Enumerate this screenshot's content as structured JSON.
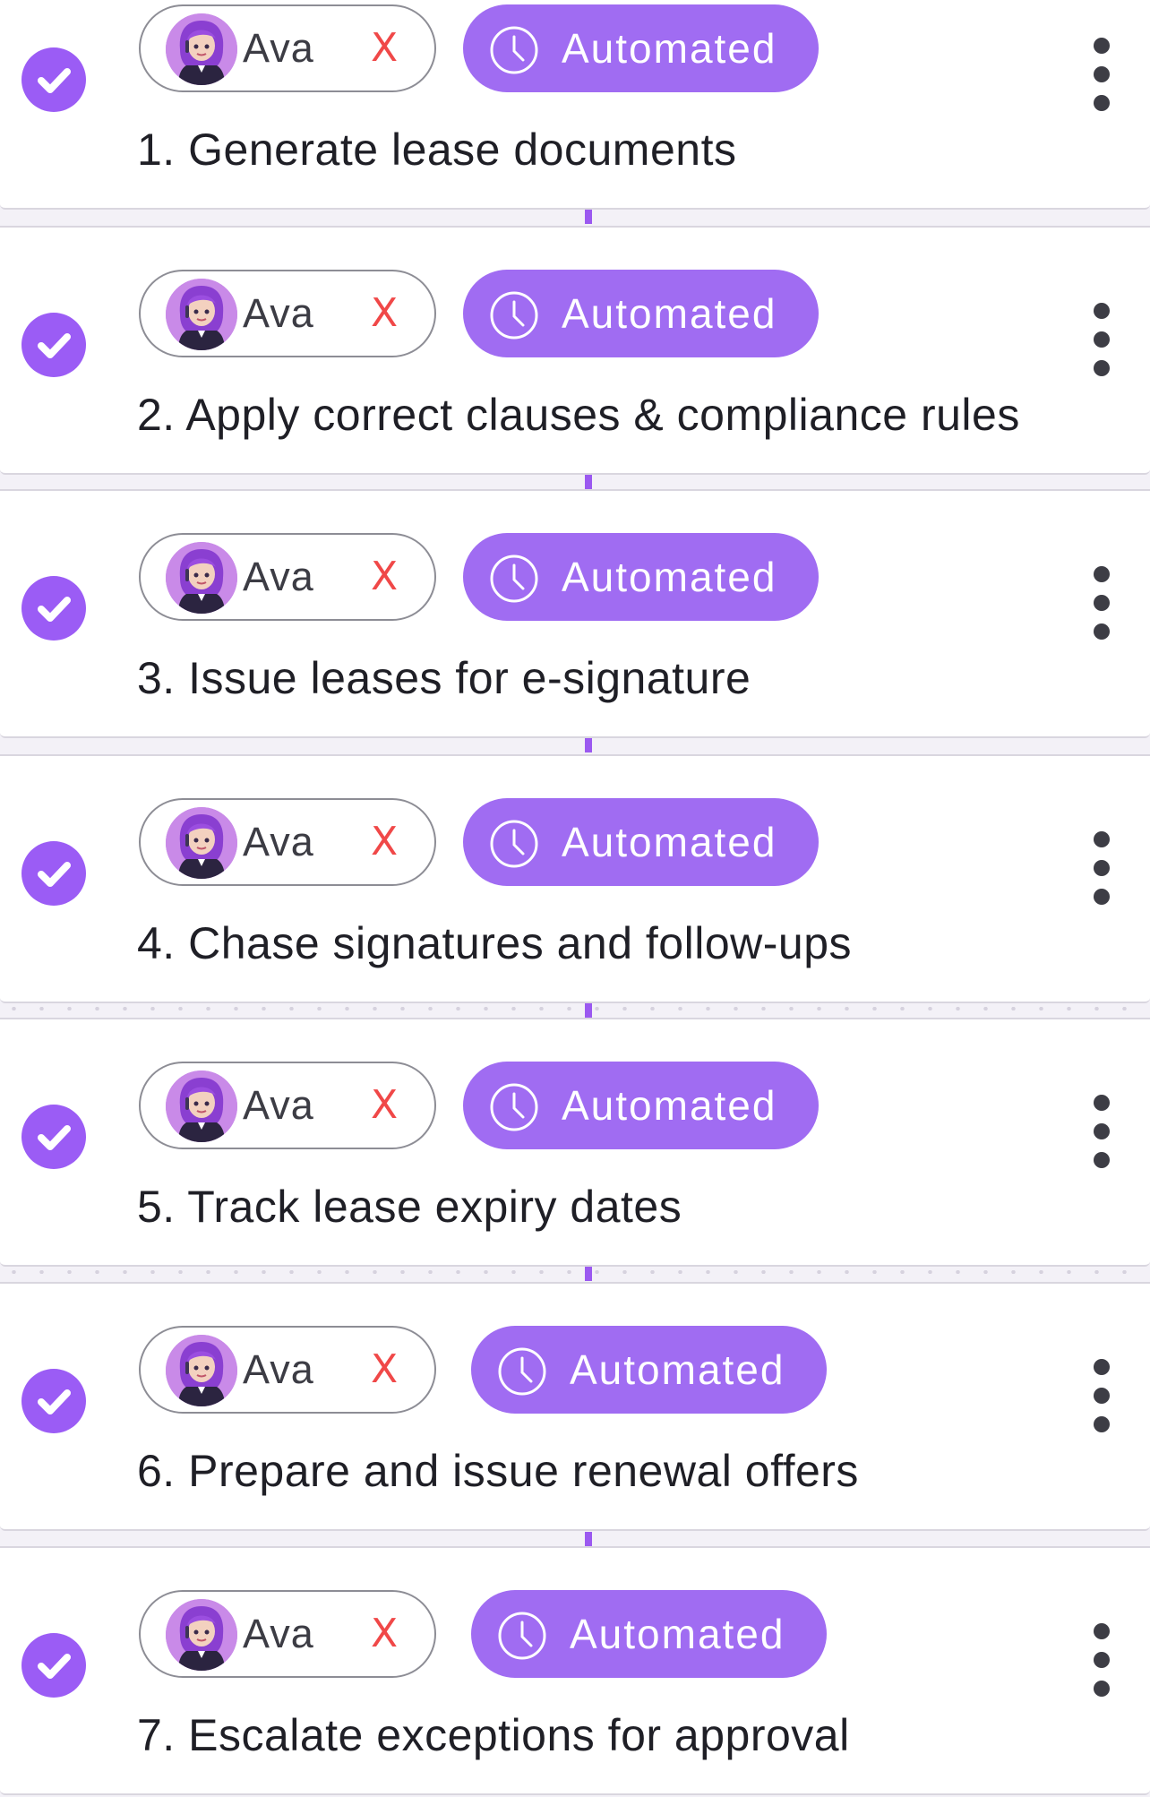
{
  "theme": {
    "accent": "#9b5cf5",
    "status_pill": "#a06cf2",
    "remove_color": "#f04848",
    "card_bg": "#ffffff",
    "page_bg": "#f3f1f7"
  },
  "tasks": [
    {
      "title": "1. Generate lease documents",
      "assignee": "Ava",
      "remove_label": "X",
      "status": "Automated",
      "completed": true
    },
    {
      "title": "2. Apply correct clauses & compliance rules",
      "assignee": "Ava",
      "remove_label": "X",
      "status": "Automated",
      "completed": true
    },
    {
      "title": "3. Issue leases for e-signature",
      "assignee": "Ava",
      "remove_label": "X",
      "status": "Automated",
      "completed": true
    },
    {
      "title": "4. Chase signatures and follow-ups",
      "assignee": "Ava",
      "remove_label": "X",
      "status": "Automated",
      "completed": true
    },
    {
      "title": "5. Track lease expiry dates",
      "assignee": "Ava",
      "remove_label": "X",
      "status": "Automated",
      "completed": true
    },
    {
      "title": "6. Prepare and issue renewal offers",
      "assignee": "Ava",
      "remove_label": "X",
      "status": "Automated",
      "completed": true
    },
    {
      "title": "7. Escalate exceptions for approval",
      "assignee": "Ava",
      "remove_label": "X",
      "status": "Automated",
      "completed": true
    }
  ],
  "icons": {
    "completed": "checkmark-circle-icon",
    "avatar": "ava-avatar-icon",
    "remove": "close-x-icon",
    "status": "clock-icon",
    "menu": "kebab-menu-icon"
  }
}
